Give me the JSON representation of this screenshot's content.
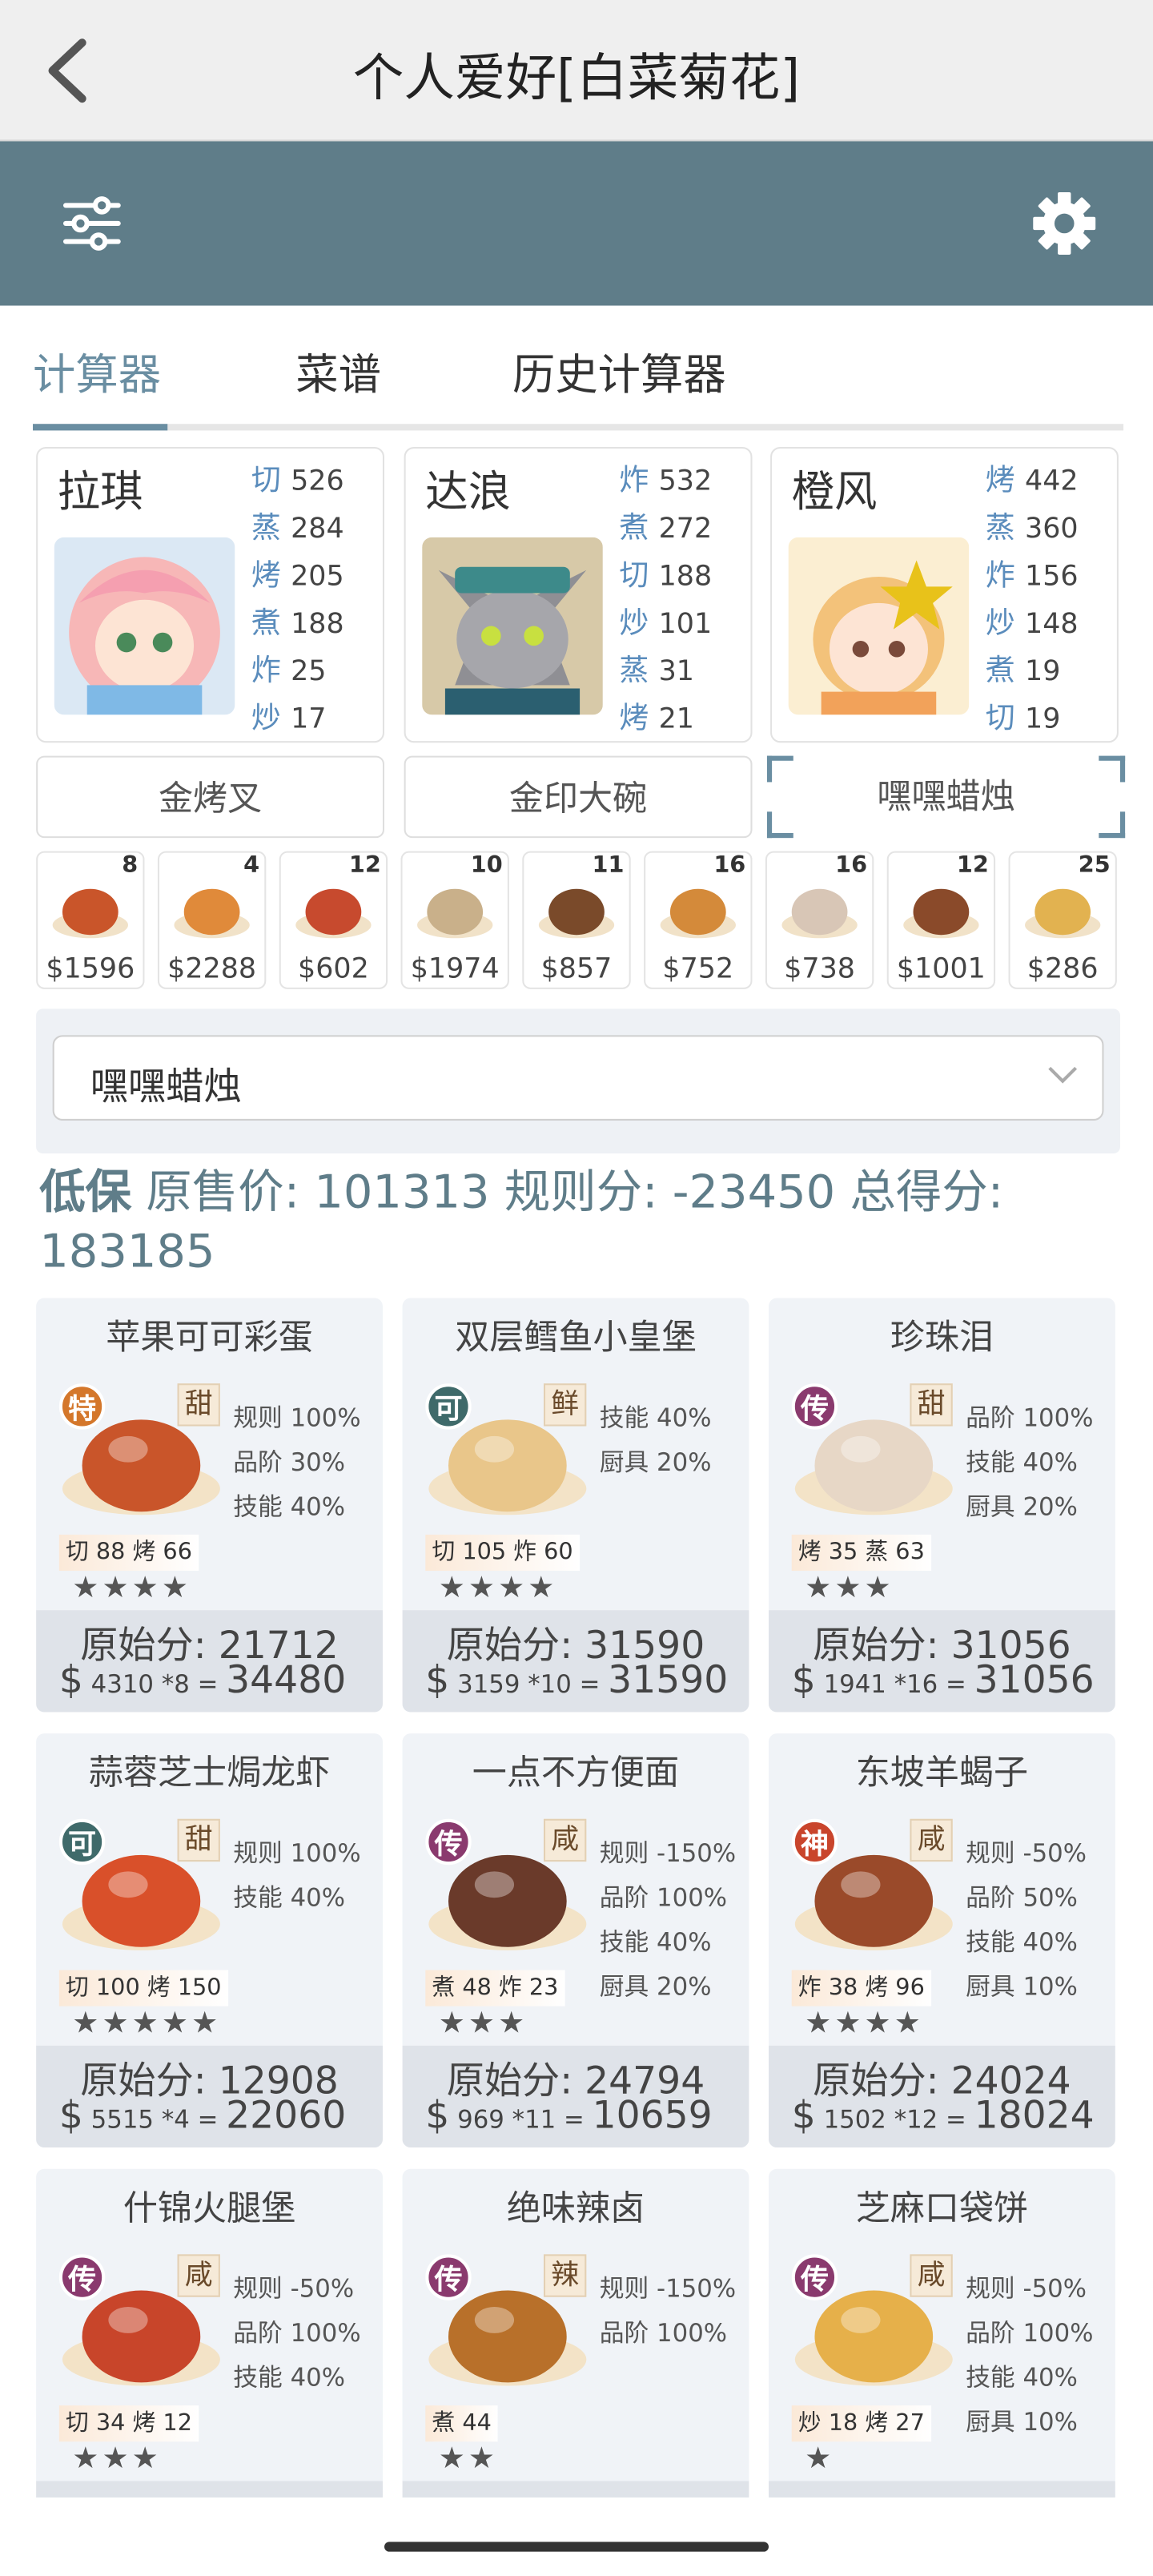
{
  "header": {
    "title": "个人爱好[白菜菊花]"
  },
  "tabs": [
    {
      "label": "计算器"
    },
    {
      "label": "菜谱"
    },
    {
      "label": "历史计算器"
    }
  ],
  "chefs": [
    {
      "name": "拉琪",
      "skills": [
        [
          "切",
          "526"
        ],
        [
          "蒸",
          "284"
        ],
        [
          "烤",
          "205"
        ],
        [
          "煮",
          "188"
        ],
        [
          "炸",
          "25"
        ],
        [
          "炒",
          "17"
        ]
      ]
    },
    {
      "name": "达浪",
      "skills": [
        [
          "炸",
          "532"
        ],
        [
          "煮",
          "272"
        ],
        [
          "切",
          "188"
        ],
        [
          "炒",
          "101"
        ],
        [
          "蒸",
          "31"
        ],
        [
          "烤",
          "21"
        ]
      ]
    },
    {
      "name": "橙风",
      "skills": [
        [
          "烤",
          "442"
        ],
        [
          "蒸",
          "360"
        ],
        [
          "炸",
          "156"
        ],
        [
          "炒",
          "148"
        ],
        [
          "煮",
          "19"
        ],
        [
          "切",
          "19"
        ]
      ]
    }
  ],
  "equipment": [
    "金烤叉",
    "金印大碗",
    "嘿嘿蜡烛"
  ],
  "dish_strip": [
    {
      "count": "8",
      "price": "$1596"
    },
    {
      "count": "4",
      "price": "$2288"
    },
    {
      "count": "12",
      "price": "$602"
    },
    {
      "count": "10",
      "price": "$1974"
    },
    {
      "count": "11",
      "price": "$857"
    },
    {
      "count": "16",
      "price": "$752"
    },
    {
      "count": "16",
      "price": "$738"
    },
    {
      "count": "12",
      "price": "$1001"
    },
    {
      "count": "25",
      "price": "$286"
    }
  ],
  "select": {
    "value": "嘿嘿蜡烛"
  },
  "summary": {
    "tag": "低保",
    "text": "原售价: 101313 规则分: -23450 总得分:",
    "total": "183185"
  },
  "dishes": [
    {
      "name": "苹果可可彩蛋",
      "rank": "特",
      "rank_color": "#d4772b",
      "flavor": "甜",
      "rules": [
        "规则 100%",
        "品阶 30%",
        "技能 40%"
      ],
      "skills": "切 88  烤 66",
      "stars": "★★★★",
      "raw": "原始分: 21712",
      "price": "4310",
      "mult": "*8",
      "total": "34480"
    },
    {
      "name": "双层鳕鱼小皇堡",
      "rank": "可",
      "rank_color": "#3f6a6a",
      "flavor": "鲜",
      "rules": [
        "技能 40%",
        "厨具 20%"
      ],
      "skills": "切 105 炸 60",
      "stars": "★★★★",
      "raw": "原始分: 31590",
      "price": "3159",
      "mult": "*10",
      "total": "31590"
    },
    {
      "name": "珍珠泪",
      "rank": "传",
      "rank_color": "#8a3a6e",
      "flavor": "甜",
      "rules": [
        "品阶 100%",
        "技能 40%",
        "厨具 20%"
      ],
      "skills": "烤 35  蒸 63",
      "stars": "★★★",
      "raw": "原始分: 31056",
      "price": "1941",
      "mult": "*16",
      "total": "31056"
    },
    {
      "name": "蒜蓉芝士焗龙虾",
      "rank": "可",
      "rank_color": "#3f6a6a",
      "flavor": "甜",
      "rules": [
        "规则 100%",
        "技能 40%"
      ],
      "skills": "切 100 烤 150",
      "stars": "★★★★★",
      "raw": "原始分: 12908",
      "price": "5515",
      "mult": "*4",
      "total": "22060"
    },
    {
      "name": "一点不方便面",
      "rank": "传",
      "rank_color": "#8a3a6e",
      "flavor": "咸",
      "rules": [
        "规则 -150%",
        "品阶 100%",
        "技能 40%",
        "厨具 20%"
      ],
      "skills": "煮 48  炸 23",
      "stars": "★★★",
      "raw": "原始分: 24794",
      "price": "969",
      "mult": "*11",
      "total": "10659"
    },
    {
      "name": "东坡羊蝎子",
      "rank": "神",
      "rank_color": "#c9452c",
      "flavor": "咸",
      "rules": [
        "规则 -50%",
        "品阶 50%",
        "技能 40%",
        "厨具 10%"
      ],
      "skills": "炸 38  烤 96",
      "stars": "★★★★",
      "raw": "原始分: 24024",
      "price": "1502",
      "mult": "*12",
      "total": "18024"
    },
    {
      "name": "什锦火腿堡",
      "rank": "传",
      "rank_color": "#8a3a6e",
      "flavor": "咸",
      "rules": [
        "规则 -50%",
        "品阶 100%",
        "技能 40%"
      ],
      "skills": "切 34  烤 12",
      "stars": "★★★",
      "raw": "",
      "price": "",
      "mult": "",
      "total": ""
    },
    {
      "name": "绝味辣卤",
      "rank": "传",
      "rank_color": "#8a3a6e",
      "flavor": "辣",
      "rules": [
        "规则 -150%",
        "品阶 100%"
      ],
      "skills": "煮 44",
      "stars": "★★",
      "raw": "",
      "price": "",
      "mult": "",
      "total": ""
    },
    {
      "name": "芝麻口袋饼",
      "rank": "传",
      "rank_color": "#8a3a6e",
      "flavor": "咸",
      "rules": [
        "规则 -50%",
        "品阶 100%",
        "技能 40%",
        "厨具 10%"
      ],
      "skills": "炒 18  烤 27",
      "stars": "★",
      "raw": "",
      "price": "",
      "mult": "",
      "total": ""
    }
  ],
  "icons": {
    "back": "chevron-left-icon",
    "filter": "sliders-icon",
    "settings": "gear-icon",
    "dropdown": "chevron-down-icon"
  },
  "colors": {
    "toolbar": "#5f7d89",
    "accent": "#6a8ea2"
  }
}
